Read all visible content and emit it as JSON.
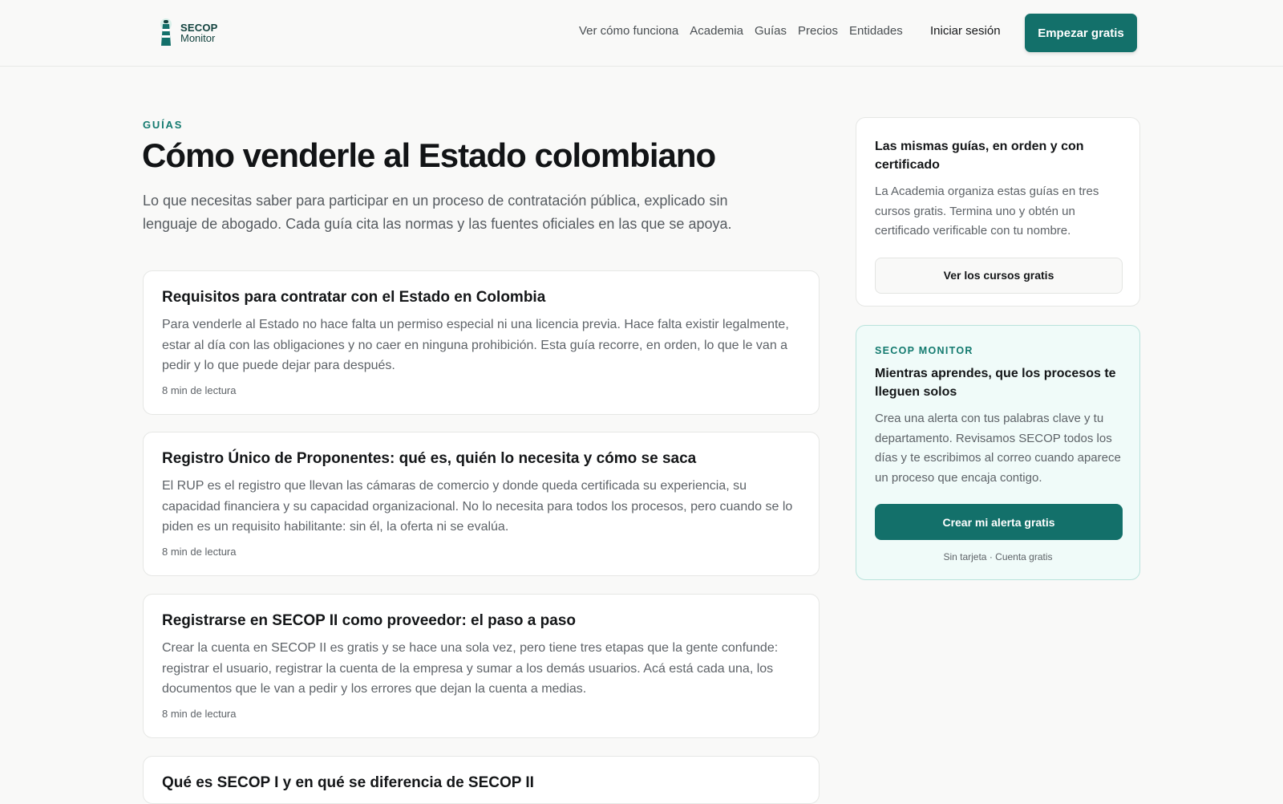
{
  "header": {
    "logo_top": "SECOP",
    "logo_bottom": "Monitor",
    "nav": [
      "Ver cómo funciona",
      "Academia",
      "Guías",
      "Precios",
      "Entidades"
    ],
    "login": "Iniciar sesión",
    "cta": "Empezar gratis"
  },
  "main": {
    "eyebrow": "GUÍAS",
    "title": "Cómo venderle al Estado colombiano",
    "intro": "Lo que necesitas saber para participar en un proceso de contratación pública, explicado sin lenguaje de abogado. Cada guía cita las normas y las fuentes oficiales en las que se apoya.",
    "cards": [
      {
        "title": "Requisitos para contratar con el Estado en Colombia",
        "text": "Para venderle al Estado no hace falta un permiso especial ni una licencia previa. Hace falta existir legalmente, estar al día con las obligaciones y no caer en ninguna prohibición. Esta guía recorre, en orden, lo que le van a pedir y lo que puede dejar para después.",
        "meta": "8 min de lectura"
      },
      {
        "title": "Registro Único de Proponentes: qué es, quién lo necesita y cómo se saca",
        "text": "El RUP es el registro que llevan las cámaras de comercio y donde queda certificada su experiencia, su capacidad financiera y su capacidad organizacional. No lo necesita para todos los procesos, pero cuando se lo piden es un requisito habilitante: sin él, la oferta ni se evalúa.",
        "meta": "8 min de lectura"
      },
      {
        "title": "Registrarse en SECOP II como proveedor: el paso a paso",
        "text": "Crear la cuenta en SECOP II es gratis y se hace una sola vez, pero tiene tres etapas que la gente confunde: registrar el usuario, registrar la cuenta de la empresa y sumar a los demás usuarios. Acá está cada una, los documentos que le van a pedir y los errores que dejan la cuenta a medias.",
        "meta": "8 min de lectura"
      },
      {
        "title": "Qué es SECOP I y en qué se diferencia de SECOP II"
      }
    ]
  },
  "sidebar": {
    "courses": {
      "title": "Las mismas guías, en orden y con certificado",
      "text": "La Academia organiza estas guías en tres cursos gratis. Termina uno y obtén un certificado verificable con tu nombre.",
      "button": "Ver los cursos gratis"
    },
    "promo": {
      "eyebrow": "SECOP MONITOR",
      "title": "Mientras aprendes, que los procesos te lleguen solos",
      "text": "Crea una alerta con tus palabras clave y tu departamento. Revisamos SECOP todos los días y te escribimos al correo cuando aparece un proceso que encaja contigo.",
      "button": "Crear mi alerta gratis",
      "note": "Sin tarjeta · Cuenta gratis"
    }
  },
  "colors": {
    "brand": "#13706a",
    "accent_text": "#137a6f",
    "promo_bg": "#f0fbf9"
  }
}
